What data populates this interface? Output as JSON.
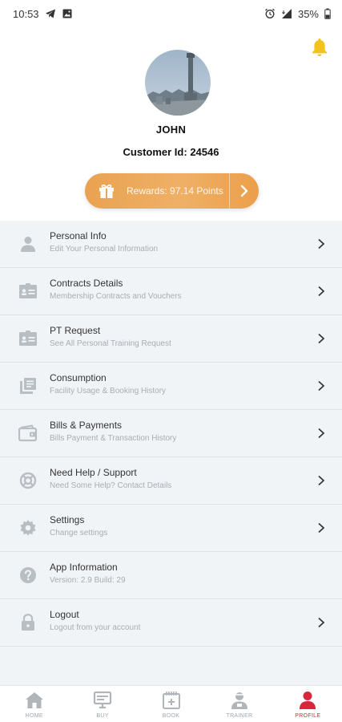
{
  "status_bar": {
    "time": "10:53",
    "battery": "35%",
    "icons": [
      "telegram-icon",
      "image-icon",
      "alarm-icon",
      "signal-icon",
      "battery-icon"
    ]
  },
  "colors": {
    "accent_orange": "#eaa454",
    "active_red": "#d9263d",
    "bell_yellow": "#f3c21b",
    "list_bg": "#f1f4f7"
  },
  "profile": {
    "name": "JOHN",
    "customer_id_label": "Customer Id:",
    "customer_id_value": "24546",
    "rewards_text": "Rewards: 97.14 Points"
  },
  "menu": [
    {
      "title": "Personal Info",
      "subtitle": "Edit Your Personal Information",
      "icon": "person-icon",
      "has_chevron": true
    },
    {
      "title": "Contracts Details",
      "subtitle": "Membership Contracts and Vouchers",
      "icon": "id-card-icon",
      "has_chevron": true
    },
    {
      "title": "PT Request",
      "subtitle": "See All Personal Training Request",
      "icon": "id-card-icon",
      "has_chevron": true
    },
    {
      "title": "Consumption",
      "subtitle": "Facility Usage & Booking History",
      "icon": "library-icon",
      "has_chevron": true
    },
    {
      "title": "Bills & Payments",
      "subtitle": "Bills Payment & Transaction History",
      "icon": "wallet-icon",
      "has_chevron": true
    },
    {
      "title": "Need Help / Support",
      "subtitle": "Need Some Help? Contact Details",
      "icon": "lifebuoy-icon",
      "has_chevron": true
    },
    {
      "title": "Settings",
      "subtitle": "Change settings",
      "icon": "gear-icon",
      "has_chevron": true
    },
    {
      "title": "App Information",
      "subtitle": "Version: 2.9 Build: 29",
      "icon": "help-circle-icon",
      "has_chevron": false
    },
    {
      "title": "Logout",
      "subtitle": "Logout from your account",
      "icon": "lock-icon",
      "has_chevron": true
    }
  ],
  "bottom_nav": [
    {
      "label": "HOME",
      "icon": "home-icon",
      "active": false
    },
    {
      "label": "BUY",
      "icon": "monitor-icon",
      "active": false
    },
    {
      "label": "BOOK",
      "icon": "calendar-icon",
      "active": false
    },
    {
      "label": "TRAINER",
      "icon": "trainer-icon",
      "active": false
    },
    {
      "label": "PROFILE",
      "icon": "profile-icon",
      "active": true
    }
  ]
}
